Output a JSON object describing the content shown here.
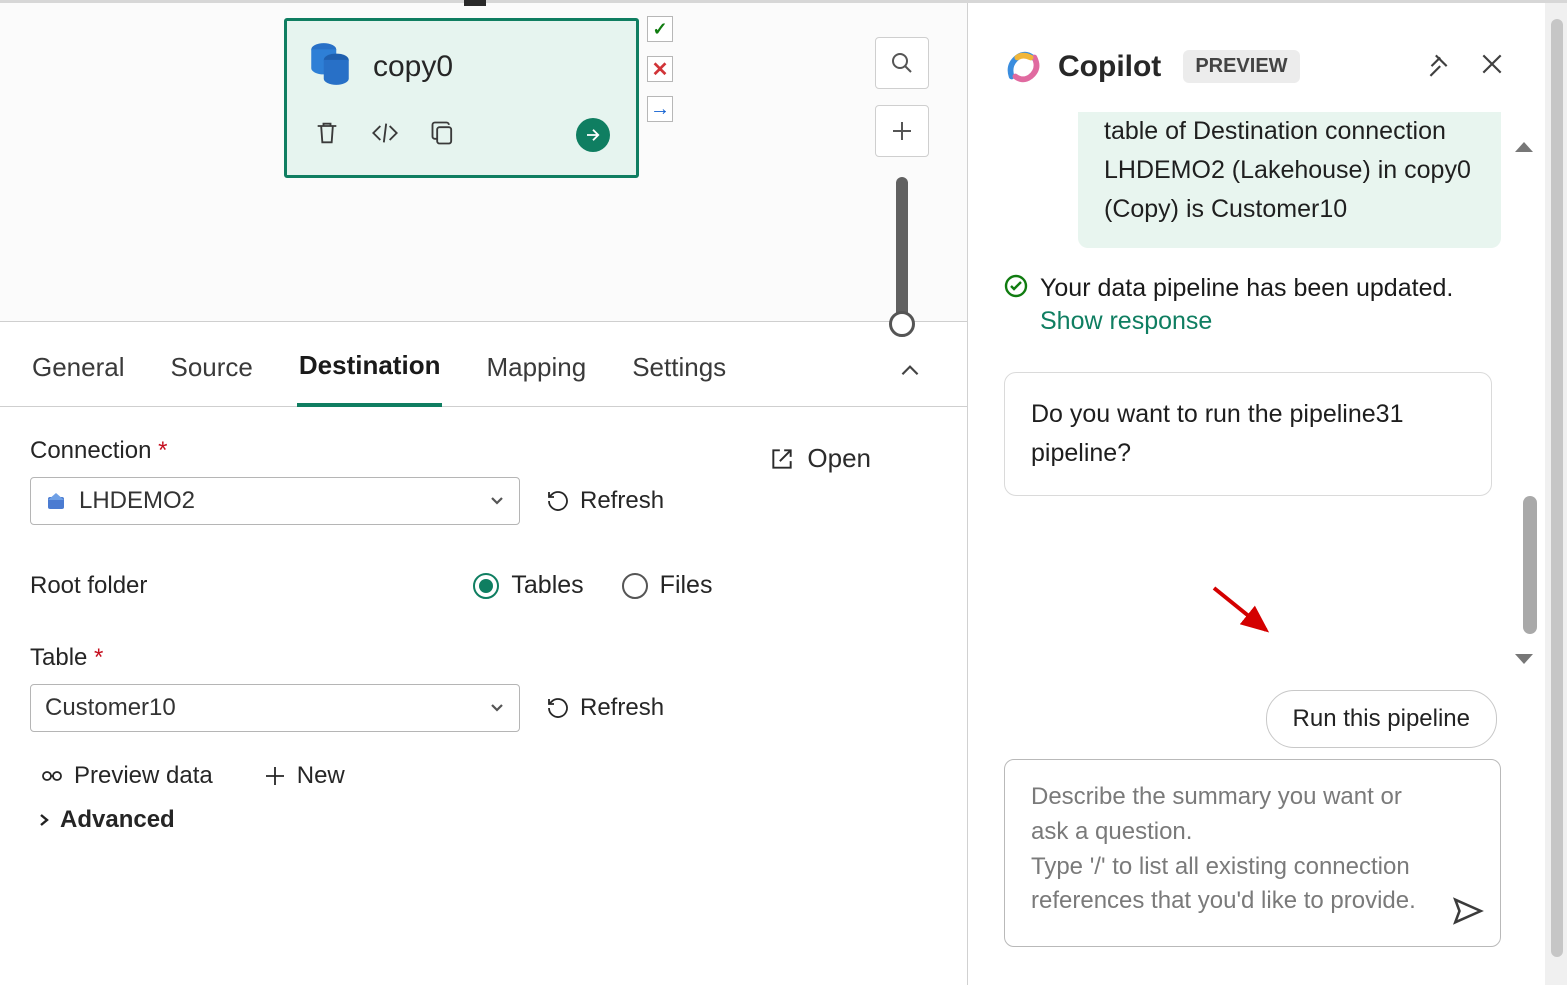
{
  "canvas": {
    "node": {
      "title": "copy0"
    },
    "status": {
      "check": "✓",
      "x": "✕",
      "arrow": "→"
    }
  },
  "tabs": {
    "general": "General",
    "source": "Source",
    "destination": "Destination",
    "mapping": "Mapping",
    "settings": "Settings",
    "active": "destination"
  },
  "destination": {
    "connection_label": "Connection",
    "connection_value": "LHDEMO2",
    "refresh": "Refresh",
    "open": "Open",
    "root_folder_label": "Root folder",
    "radio_tables": "Tables",
    "radio_files": "Files",
    "root_folder_selected": "tables",
    "table_label": "Table",
    "table_value": "Customer10",
    "preview_data": "Preview data",
    "new": "New",
    "advanced": "Advanced"
  },
  "copilot": {
    "title": "Copilot",
    "badge": "PREVIEW",
    "green_message": "table of Destination connection LHDEMO2 (Lakehouse) in copy0 (Copy) is Customer10",
    "updated": "Your data pipeline has been updated.",
    "show_response": "Show response",
    "question": "Do you want to run the pipeline31 pipeline?",
    "run_button": "Run this pipeline",
    "placeholder": "Describe the summary you want or ask a question.\nType '/' to list all existing connection references that you'd like to provide."
  }
}
